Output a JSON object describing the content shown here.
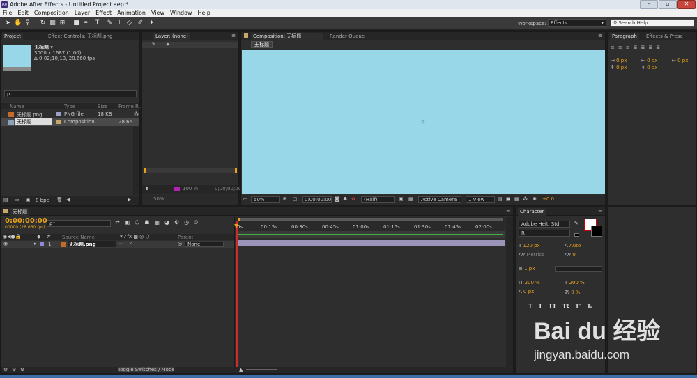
{
  "window": {
    "title": "Adobe After Effects - Untitled Project.aep *",
    "app_icon": "Ae"
  },
  "menu": [
    "File",
    "Edit",
    "Composition",
    "Layer",
    "Effect",
    "Animation",
    "View",
    "Window",
    "Help"
  ],
  "toolbar": {
    "workspace_label": "Workspace:",
    "workspace_value": "Effects",
    "search_placeholder": "Search Help"
  },
  "project": {
    "tab": "Project",
    "effect_controls_tab": "Effect Controls: 无标题.png",
    "selected_name": "无标题 ▾",
    "selected_info1": "3000 x 1687 (1.00)",
    "selected_info2": "Δ 0;02;10;13, 28.660 fps",
    "search_placeholder": "ρ⁻",
    "columns": [
      "Name",
      "Type",
      "Size",
      "Frame R..."
    ],
    "items": [
      {
        "name": "无标题.png",
        "type": "PNG file",
        "size": "18 KB",
        "frame": ""
      },
      {
        "name": "无标题",
        "type": "Composition",
        "size": "",
        "frame": "28.66"
      }
    ],
    "bpc": "8 bpc"
  },
  "layer_panel": {
    "tab": "Layer: (none)",
    "zoom": "50%",
    "percent": "100 %",
    "time": "0;00;00;00"
  },
  "composition": {
    "tab": "Composition: 无标题",
    "render_tab": "Render Queue",
    "comp_chip": "无标题",
    "bg_color": "#97d7e8",
    "zoom": "50%",
    "timecode": "0:00:00:00",
    "resolution": "(Half)",
    "camera": "Active Camera",
    "view": "1 View",
    "exposure": "+0.0"
  },
  "paragraph": {
    "tab": "Paragraph",
    "tab2": "Effects & Prese",
    "fields": [
      "0 px",
      "0 px",
      "0 px",
      "0 px",
      "0 px"
    ]
  },
  "timeline": {
    "tab": "无标题",
    "timecode": "0:00:00:00",
    "fps": "00000 (28.660 fps)",
    "search_placeholder": "ρ⁻",
    "ruler": [
      "0s",
      "00:15s",
      "00:30s",
      "00:45s",
      "01:00s",
      "01:15s",
      "01:30s",
      "01:45s",
      "02:00s"
    ],
    "col_source": "Source Name",
    "col_parent": "Parent",
    "layer": {
      "num": "1",
      "name": "无标题.png",
      "parent": "None"
    },
    "toggle_label": "Toggle Switches / Modes"
  },
  "character": {
    "tab": "Character",
    "font": "Adobe Heiti Std",
    "style": "R",
    "size": "120 px",
    "leading": "Auto",
    "kerning": "Metrics",
    "tracking": "0",
    "stroke": "1 px",
    "vscale": "200 %",
    "hscale": "200 %",
    "baseline": "0 px",
    "tsume": "0 %"
  },
  "watermark": {
    "brand": "Bai du 经验",
    "url": "jingyan.baidu.com"
  }
}
